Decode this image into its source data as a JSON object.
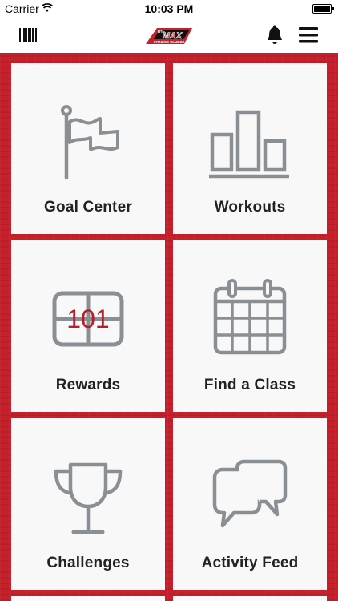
{
  "status_bar": {
    "carrier": "Carrier",
    "time": "10:03 PM"
  },
  "nav": {
    "logo_text_top": "THE",
    "logo_text_main": "MAX",
    "logo_text_sub": "FITNESS CLUBZZ",
    "icons": [
      "barcode-icon",
      "bell-icon",
      "menu-icon"
    ]
  },
  "tiles": [
    {
      "label": "Goal Center",
      "icon": "flag-icon"
    },
    {
      "label": "Workouts",
      "icon": "bar-chart-icon"
    },
    {
      "label": "Rewards",
      "icon": "scoreboard-icon",
      "icon_text": "101"
    },
    {
      "label": "Find a Class",
      "icon": "calendar-icon"
    },
    {
      "label": "Challenges",
      "icon": "trophy-icon"
    },
    {
      "label": "Activity Feed",
      "icon": "chat-bubbles-icon"
    }
  ],
  "colors": {
    "brand_red": "#c5202b",
    "icon_gray": "#8a8f94",
    "tile_bg": "#f8f8f8",
    "text_dark": "#222222"
  }
}
